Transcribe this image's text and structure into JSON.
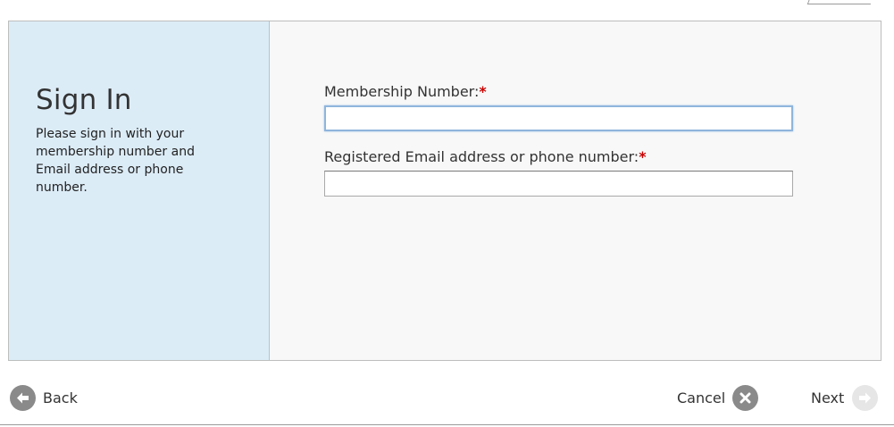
{
  "sidebar": {
    "title": "Sign In",
    "description": "Please sign in with your membership number and Email address or phone number."
  },
  "form": {
    "membership_label": "Membership Number:",
    "membership_required": "*",
    "membership_value": "",
    "contact_label": "Registered Email address or phone number:",
    "contact_required": "*",
    "contact_value": ""
  },
  "footer": {
    "back_label": "Back",
    "cancel_label": "Cancel",
    "next_label": "Next"
  },
  "icons": {
    "back": "arrow-left-circle-icon",
    "cancel": "close-circle-icon",
    "next": "arrow-right-circle-icon"
  },
  "colors": {
    "sidebar_bg": "#dcecf7",
    "required_marker": "#c80000",
    "focused_border": "#8fb5dc"
  }
}
